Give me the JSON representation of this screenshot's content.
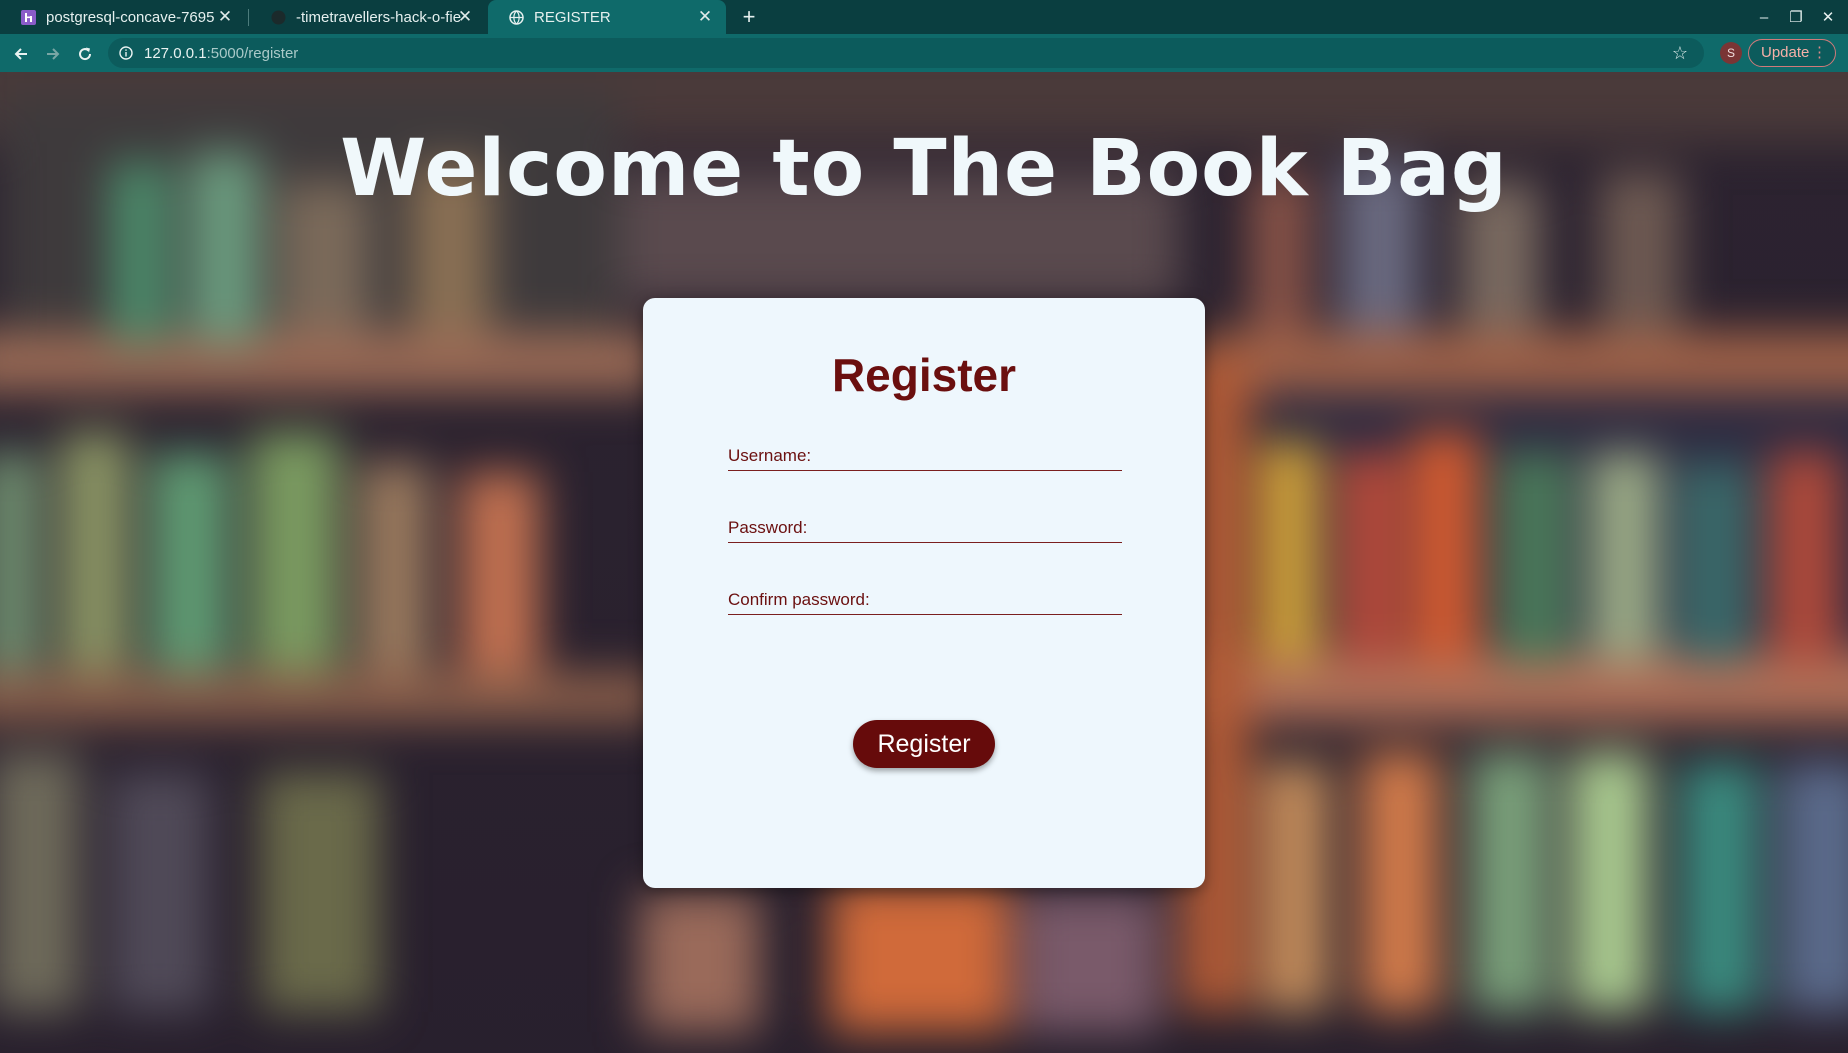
{
  "browser": {
    "tabs": [
      {
        "title": "postgresql-concave-7695",
        "icon": "heroku-icon",
        "active": false
      },
      {
        "title": "-timetravellers-hack-o-fie",
        "icon": "github-icon",
        "active": false
      },
      {
        "title": "REGISTER",
        "icon": "globe-icon",
        "active": true
      }
    ],
    "url_host": "127.0.0.1",
    "url_path": ":5000/register",
    "profile_initial": "S",
    "update_label": "Update"
  },
  "page": {
    "headline": "Welcome to The Book Bag",
    "form": {
      "title": "Register",
      "username_label": "Username:",
      "password_label": "Password:",
      "confirm_label": "Confirm password:",
      "submit_label": "Register"
    }
  },
  "colors": {
    "chrome_dark": "#0a3e40",
    "chrome_teal": "#0f6a6a",
    "card_bg": "#eef7fd",
    "accent": "#660b0b"
  }
}
